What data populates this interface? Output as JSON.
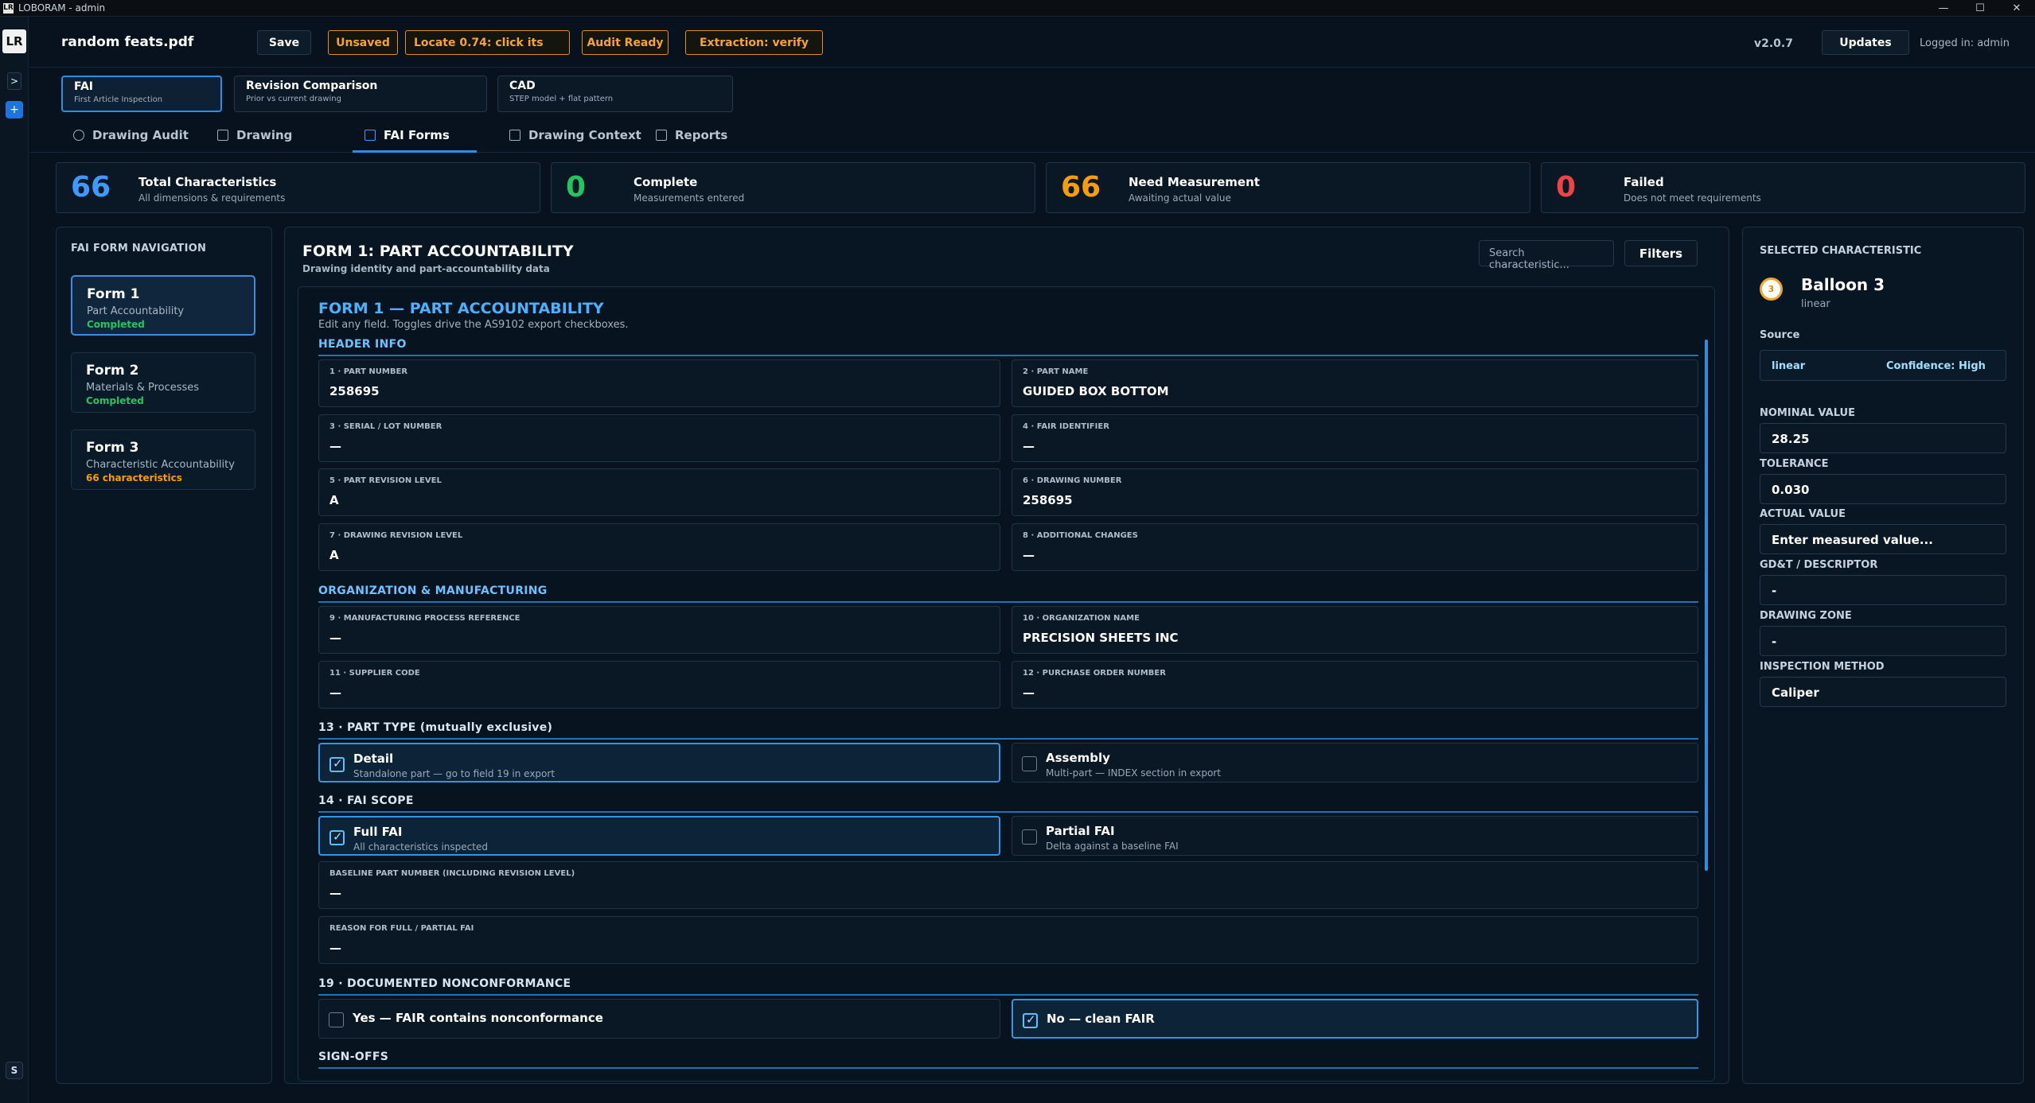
{
  "window": {
    "title": "LOBORAM - admin",
    "app_icon": "LR",
    "controls": [
      "—",
      "☐",
      "✕"
    ]
  },
  "rail": {
    "logo": "LR",
    "expand": ">",
    "add": "+",
    "user_initial": "S"
  },
  "header": {
    "filename": "random feats.pdf",
    "save_label": "Save",
    "badges": [
      "Unsaved",
      "Locate 0.74: click its",
      "Audit Ready",
      "Extraction: verify"
    ],
    "version": "v2.0.7",
    "updates_label": "Updates",
    "logged_in": "Logged in: admin"
  },
  "modes": [
    {
      "title": "FAI",
      "subtitle": "First Article Inspection"
    },
    {
      "title": "Revision Comparison",
      "subtitle": "Prior vs current drawing"
    },
    {
      "title": "CAD",
      "subtitle": "STEP model + flat pattern"
    }
  ],
  "subtabs": [
    "Drawing Audit",
    "Drawing",
    "FAI Forms",
    "Drawing Context",
    "Reports"
  ],
  "stats": [
    {
      "value": "66",
      "label": "Total Characteristics",
      "sub": "All dimensions & requirements",
      "color": "#3d9bff"
    },
    {
      "value": "0",
      "label": "Complete",
      "sub": "Measurements entered",
      "color": "#22c55e"
    },
    {
      "value": "66",
      "label": "Need Measurement",
      "sub": "Awaiting actual value",
      "color": "#f59e0b"
    },
    {
      "value": "0",
      "label": "Failed",
      "sub": "Does not meet requirements",
      "color": "#ef4444"
    }
  ],
  "nav": {
    "header": "FAI FORM NAVIGATION",
    "items": [
      {
        "title": "Form 1",
        "subtitle": "Part Accountability",
        "status": "Completed"
      },
      {
        "title": "Form 2",
        "subtitle": "Materials & Processes",
        "status": "Completed"
      },
      {
        "title": "Form 3",
        "subtitle": "Characteristic Accountability",
        "status": "66 characteristics"
      }
    ]
  },
  "form": {
    "title": "FORM 1: PART ACCOUNTABILITY",
    "subtitle": "Drawing identity and part-accountability data",
    "search_placeholder": "Search characteristic...",
    "filters_label": "Filters",
    "inner_title": "FORM 1 — PART ACCOUNTABILITY",
    "inner_sub": "Edit any field. Toggles drive the AS9102 export checkboxes.",
    "sections": {
      "header_info": "HEADER INFO",
      "org": "ORGANIZATION & MANUFACTURING",
      "part_type": "13 · PART TYPE (mutually exclusive)",
      "fai_scope": "14 · FAI SCOPE",
      "nonconf": "19 · DOCUMENTED NONCONFORMANCE",
      "signoffs": "SIGN-OFFS"
    },
    "fields": {
      "f1": {
        "label": "1 · PART NUMBER",
        "value": "258695"
      },
      "f2": {
        "label": "2 · PART NAME",
        "value": "GUIDED BOX BOTTOM"
      },
      "f3": {
        "label": "3 · SERIAL / LOT NUMBER",
        "value": "—"
      },
      "f4": {
        "label": "4 · FAIR IDENTIFIER",
        "value": "—"
      },
      "f5": {
        "label": "5 · PART REVISION LEVEL",
        "value": "A"
      },
      "f6": {
        "label": "6 · DRAWING NUMBER",
        "value": "258695"
      },
      "f7": {
        "label": "7 · DRAWING REVISION LEVEL",
        "value": "A"
      },
      "f8": {
        "label": "8 · ADDITIONAL CHANGES",
        "value": "—"
      },
      "f9": {
        "label": "9 · MANUFACTURING PROCESS REFERENCE",
        "value": "—"
      },
      "f10": {
        "label": "10 · ORGANIZATION NAME",
        "value": "PRECISION SHEETS INC"
      },
      "f11": {
        "label": "11 · SUPPLIER CODE",
        "value": "—"
      },
      "f12": {
        "label": "12 · PURCHASE ORDER NUMBER",
        "value": "—"
      },
      "baseline": {
        "label": "BASELINE PART NUMBER (INCLUDING REVISION LEVEL)",
        "value": "—"
      },
      "reason": {
        "label": "REASON FOR FULL / PARTIAL FAI",
        "value": "—"
      }
    },
    "part_type": {
      "detail": {
        "title": "Detail",
        "sub": "Standalone part — go to field 19 in export",
        "checked": true
      },
      "assembly": {
        "title": "Assembly",
        "sub": "Multi-part — INDEX section in export",
        "checked": false
      }
    },
    "fai_scope": {
      "full": {
        "title": "Full FAI",
        "sub": "All characteristics inspected",
        "checked": true
      },
      "partial": {
        "title": "Partial FAI",
        "sub": "Delta against a baseline FAI",
        "checked": false
      }
    },
    "nonconformance": {
      "yes": {
        "title": "Yes — FAIR contains nonconformance",
        "checked": false
      },
      "no": {
        "title": "No — clean FAIR",
        "checked": true
      }
    }
  },
  "selected": {
    "header": "SELECTED CHARACTERISTIC",
    "balloon_number": "3",
    "name": "Balloon 3",
    "type": "linear",
    "source_label": "Source",
    "source_value": "linear",
    "confidence": "Confidence: High",
    "nominal_label": "NOMINAL VALUE",
    "nominal_value": "28.25",
    "tolerance_label": "TOLERANCE",
    "tolerance_value": "0.030",
    "actual_label": "ACTUAL VALUE",
    "actual_placeholder": "Enter measured value...",
    "gdt_label": "GD&T / DESCRIPTOR",
    "gdt_value": "-",
    "zone_label": "DRAWING ZONE",
    "zone_value": "-",
    "method_label": "INSPECTION METHOD",
    "method_value": "Caliper"
  }
}
